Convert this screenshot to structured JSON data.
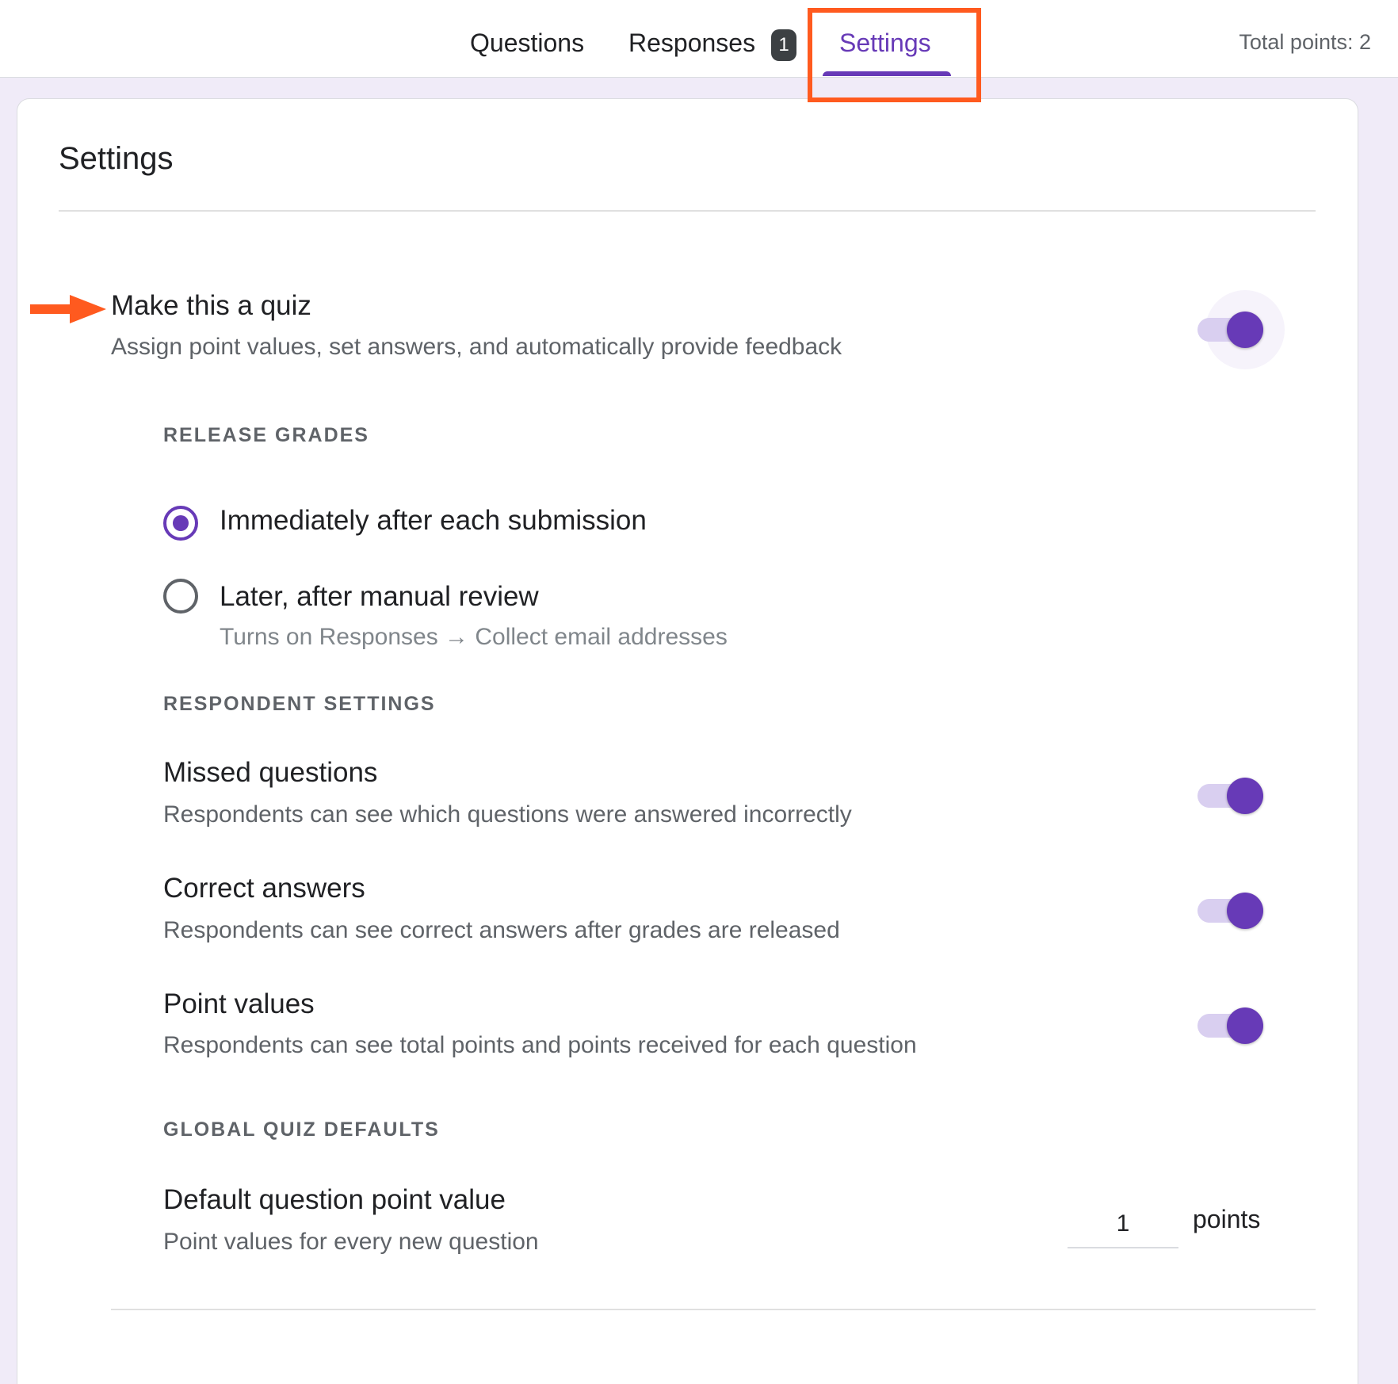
{
  "tabs": {
    "questions": "Questions",
    "responses": "Responses",
    "responses_badge": "1",
    "settings": "Settings"
  },
  "total_points": "Total points: 2",
  "card_title": "Settings",
  "quiz": {
    "title": "Make this a quiz",
    "description": "Assign point values, set answers, and automatically provide feedback",
    "enabled": true
  },
  "release_grades": {
    "label": "RELEASE GRADES",
    "options": [
      {
        "label": "Immediately after each submission",
        "selected": true
      },
      {
        "label": "Later, after manual review",
        "hint": "Turns on Responses → Collect email addresses",
        "selected": false
      }
    ]
  },
  "respondent_settings": {
    "label": "RESPONDENT SETTINGS",
    "items": [
      {
        "title": "Missed questions",
        "description": "Respondents can see which questions were answered incorrectly",
        "enabled": true
      },
      {
        "title": "Correct answers",
        "description": "Respondents can see correct answers after grades are released",
        "enabled": true
      },
      {
        "title": "Point values",
        "description": "Respondents can see total points and points received for each question",
        "enabled": true
      }
    ]
  },
  "global_defaults": {
    "label": "GLOBAL QUIZ DEFAULTS",
    "title": "Default question point value",
    "description": "Point values for every new question",
    "value": "1",
    "unit": "points"
  },
  "colors": {
    "accent": "#673ab7",
    "highlight": "#ff5a1f",
    "background": "#f0ebf8"
  }
}
